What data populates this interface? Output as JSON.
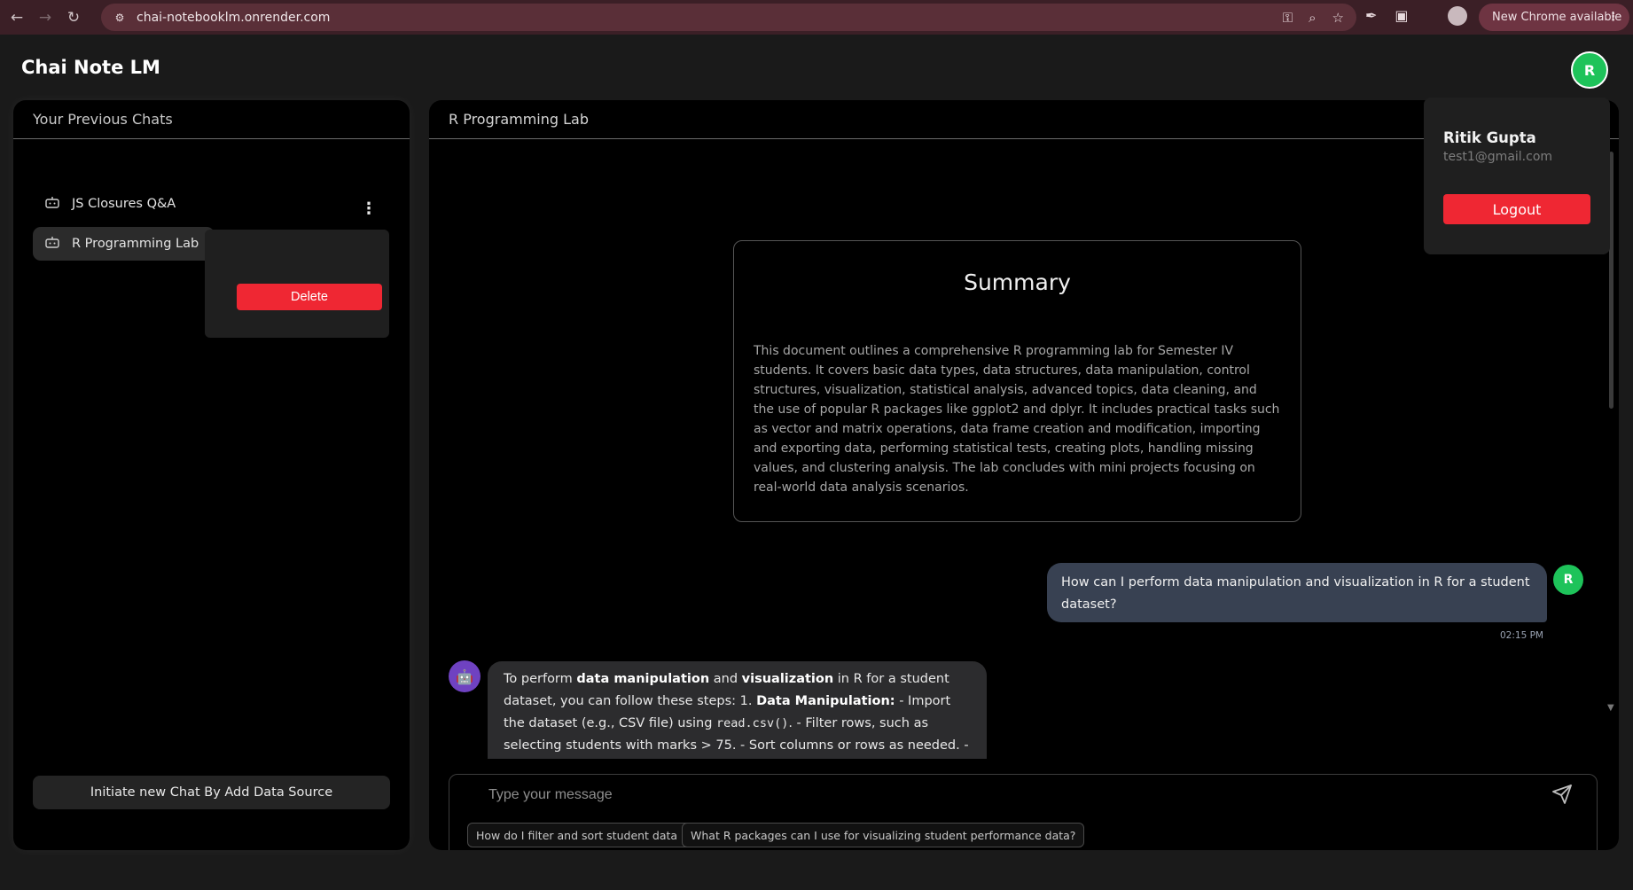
{
  "browser": {
    "url": "chai-notebooklm.onrender.com",
    "update_label": "New Chrome available"
  },
  "app": {
    "title": "Chai Note LM",
    "avatar_initial": "R"
  },
  "sidebar": {
    "header": "Your Previous Chats",
    "chats": [
      {
        "label": "JS Closures Q&A"
      },
      {
        "label": "R Programming Lab"
      }
    ],
    "delete_label": "Delete",
    "new_chat_label": "Initiate new Chat By Add Data Source"
  },
  "main": {
    "header": "R Programming Lab",
    "summary": {
      "title": "Summary",
      "text": "This document outlines a comprehensive R programming lab for Semester IV students. It covers basic data types, data structures, data manipulation, control structures, visualization, statistical analysis, advanced topics, data cleaning, and the use of popular R packages like ggplot2 and dplyr. It includes practical tasks such as vector and matrix operations, data frame creation and modification, importing and exporting data, performing statistical tests, creating plots, handling missing values, and clustering analysis. The lab concludes with mini projects focusing on real-world data analysis scenarios."
    },
    "user_message": {
      "text": "How can I perform data manipulation and visualization in R for a student dataset?",
      "time": "02:15 PM",
      "avatar": "R"
    },
    "bot_message": {
      "p1": "To perform ",
      "b1": "data manipulation",
      "p2": " and ",
      "b2": "visualization",
      "p3": " in R for a student dataset, you can follow these steps: 1. ",
      "b3": "Data Manipulation:",
      "p4": " - Import the dataset (e.g., CSV file) using ",
      "code1": "read.csv()",
      "p5": ". - Filter rows, such as selecting students with marks > 75. - Sort columns or rows as needed. - Add new columns, for"
    },
    "composer": {
      "placeholder": "Type your message",
      "suggestions": [
        "How do I filter and sort student data in R?",
        "What R packages can I use for visualizing student performance data?"
      ]
    }
  },
  "profile": {
    "name": "Ritik Gupta",
    "email": "test1@gmail.com",
    "logout_label": "Logout"
  },
  "icons": {
    "back": "arrow-left-icon",
    "forward": "arrow-right-icon",
    "reload": "reload-icon",
    "site_info": "site-settings-icon",
    "password": "key-icon",
    "zoom": "zoom-icon",
    "bookmark": "star-icon",
    "extension_a": "eyedropper-icon",
    "extension_b": "puzzle-icon",
    "chat": "robot-icon",
    "menu": "kebab-icon",
    "send": "send-icon",
    "bot": "bot-avatar-icon"
  },
  "colors": {
    "accent_green": "#1ec35a",
    "danger_red": "#ef2733",
    "bot_purple": "#6f42c1",
    "user_bubble": "#384152"
  }
}
